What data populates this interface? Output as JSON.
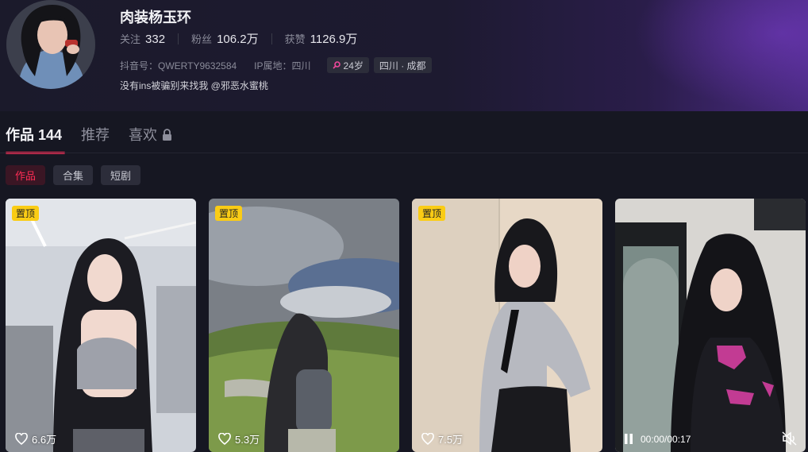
{
  "profile": {
    "nickname": "肉装杨玉环",
    "stats": [
      {
        "label": "关注",
        "value": "332"
      },
      {
        "label": "粉丝",
        "value": "106.2万"
      },
      {
        "label": "获赞",
        "value": "1126.9万"
      }
    ],
    "douyin_id": "抖音号：QWERTY9632584",
    "ip_location": "IP属地：四川",
    "age_tag": "24岁",
    "region_tag": "四川 · 成都",
    "bio": "没有ins被骗别来找我 @邪恶水蜜桃"
  },
  "tabs": [
    {
      "label": "作品 144",
      "active": true
    },
    {
      "label": "推荐",
      "active": false
    },
    {
      "label": "喜欢",
      "active": false,
      "icon": "lock-icon"
    }
  ],
  "filters": [
    "作品",
    "合集",
    "短剧"
  ],
  "videos": [
    {
      "pinned_label": "置顶",
      "likes": "6.6万"
    },
    {
      "pinned_label": "置顶",
      "likes": "5.3万"
    },
    {
      "pinned_label": "置顶",
      "likes": "7.5万"
    },
    {
      "time": "00:00/00:17"
    }
  ],
  "colors": {
    "accent": "#fe2c55",
    "pin": "#facc15",
    "background": "#161722"
  }
}
